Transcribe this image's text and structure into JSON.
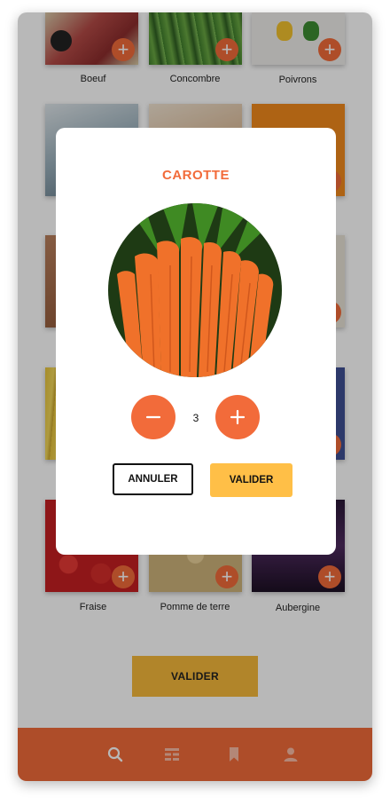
{
  "grid": {
    "items": [
      {
        "label": "Boeuf"
      },
      {
        "label": "Concombre"
      },
      {
        "label": "Poivrons"
      },
      {
        "label": "Fraise"
      },
      {
        "label": "Pomme de terre"
      },
      {
        "label": "Aubergine"
      }
    ]
  },
  "page": {
    "validate_label": "VALIDER"
  },
  "modal": {
    "title": "CAROTTE",
    "minus_symbol": "−",
    "plus_symbol": "+",
    "quantity": "3",
    "cancel_label": "ANNULER",
    "validate_label": "VALIDER"
  },
  "tabbar": {
    "tabs": [
      {
        "icon": "search-icon",
        "active": true
      },
      {
        "icon": "list-icon",
        "active": false
      },
      {
        "icon": "bookmark-icon",
        "active": false
      },
      {
        "icon": "user-icon",
        "active": false
      }
    ]
  },
  "colors": {
    "accent": "#f26b3a",
    "yellow": "#ffbf47"
  }
}
